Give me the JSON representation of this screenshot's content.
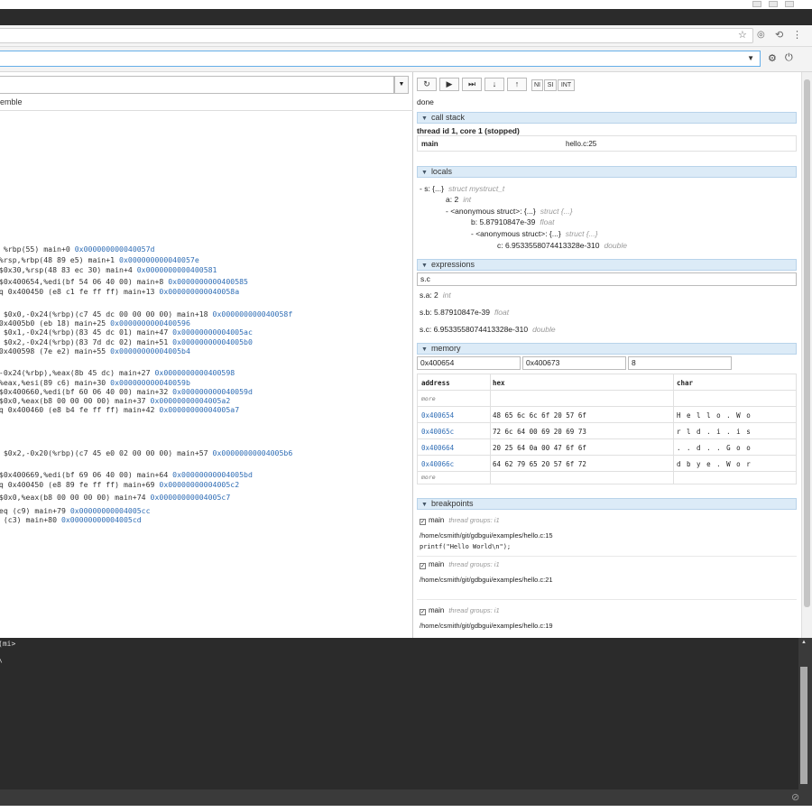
{
  "browser": {
    "star_icon": "star-icon",
    "window_controls": [
      "minimize",
      "maximize",
      "close"
    ]
  },
  "topbar": {
    "command_value": "",
    "settings_icon": "gear-icon",
    "power_icon": "power-icon"
  },
  "source": {
    "file_value": "",
    "disassemble_label": "emble",
    "asm_lines": [
      {
        "pre": "n %rbp(55) main+0 ",
        "addr": "0x000000000040057d"
      },
      {
        "pre": " %rsp,%rbp(48 89 e5) main+1 ",
        "addr": "0x000000000040057e"
      },
      {
        "pre": " $0x30,%rsp(48 83 ec 30) main+4 ",
        "addr": "0x0000000000400581"
      },
      {
        "pre": " $0x400654,%edi(bf 54 06 40 00) main+8 ",
        "addr": "0x0000000000400585"
      },
      {
        "pre": "lq 0x400450 (e8 c1 fe ff ff) main+13 ",
        "addr": "0x000000000040058a"
      },
      {
        "pre": "l $0x0,-0x24(%rbp)(c7 45 dc 00 00 00 00) main+18 ",
        "addr": "0x000000000040058f"
      },
      {
        "pre": " 0x4005b0 (eb 18) main+25 ",
        "addr": "0x0000000000400596"
      },
      {
        "pre": "l $0x1,-0x24(%rbp)(83 45 dc 01) main+47 ",
        "addr": "0x00000000004005ac"
      },
      {
        "pre": "l $0x2,-0x24(%rbp)(83 7d dc 02) main+51 ",
        "addr": "0x00000000004005b0"
      },
      {
        "pre": " 0x400598 (7e e2) main+55 ",
        "addr": "0x00000000004005b4"
      },
      {
        "pre": " -0x24(%rbp),%eax(8b 45 dc) main+27 ",
        "addr": "0x0000000000400598"
      },
      {
        "pre": " %eax,%esi(89 c6) main+30 ",
        "addr": "0x000000000040059b"
      },
      {
        "pre": " $0x400660,%edi(bf 60 06 40 00) main+32 ",
        "addr": "0x000000000040059d"
      },
      {
        "pre": " $0x0,%eax(b8 00 00 00 00) main+37 ",
        "addr": "0x00000000004005a2"
      },
      {
        "pre": "lq 0x400460 (e8 b4 fe ff ff) main+42 ",
        "addr": "0x00000000004005a7"
      },
      {
        "pre": "l $0x2,-0x20(%rbp)(c7 45 e0 02 00 00 00) main+57 ",
        "addr": "0x00000000004005b6"
      },
      {
        "pre": " $0x400669,%edi(bf 69 06 40 00) main+64 ",
        "addr": "0x00000000004005bd"
      },
      {
        "pre": "lq 0x400450 (e8 89 fe ff ff) main+69 ",
        "addr": "0x00000000004005c2"
      },
      {
        "pre": " $0x0,%eax(b8 00 00 00 00) main+74 ",
        "addr": "0x00000000004005c7"
      },
      {
        "pre": "veq (c9) main+79 ",
        "addr": "0x00000000004005cc"
      },
      {
        "pre": "q (c3) main+80 ",
        "addr": "0x00000000004005cd"
      }
    ]
  },
  "controls": {
    "ni": "NI",
    "si": "SI",
    "int": "INT",
    "status": "done"
  },
  "callstack": {
    "title": "call stack",
    "thread": "thread id 1, core 1 (stopped)",
    "frame_func": "main",
    "frame_loc": "hello.c:25"
  },
  "locals": {
    "title": "locals",
    "l1": "- s: {...}",
    "l1t": "struct mystruct_t",
    "l2": "a: 2",
    "l2t": "int",
    "l3": "- <anonymous struct>: {...}",
    "l3t": "struct {...}",
    "l4": "b: 5.87910847e-39",
    "l4t": "float",
    "l5": "- <anonymous struct>: {...}",
    "l5t": "struct {...}",
    "l6": "c: 6.9533558074413328e-310",
    "l6t": "double"
  },
  "expressions": {
    "title": "expressions",
    "input": "s.c",
    "e1": "s.a: 2",
    "e1t": "int",
    "e2": "s.b: 5.87910847e-39",
    "e2t": "float",
    "e3": "s.c: 6.9533558074413328e-310",
    "e3t": "double"
  },
  "memory": {
    "title": "memory",
    "start": "0x400654",
    "end": "0x400673",
    "bytes": "8",
    "col_address": "address",
    "col_hex": "hex",
    "col_char": "char",
    "more": "more",
    "rows": [
      {
        "addr": "0x400654",
        "hex": "48 65 6c 6c 6f 20 57 6f",
        "chr": "H e l l o . W o"
      },
      {
        "addr": "0x40065c",
        "hex": "72 6c 64 00 69 20 69 73",
        "chr": "r l d . i . i s"
      },
      {
        "addr": "0x400664",
        "hex": "20 25 64 0a 00 47 6f 6f",
        "chr": ". . d . . G o o"
      },
      {
        "addr": "0x40066c",
        "hex": "64 62 79 65 20 57 6f 72",
        "chr": "d b y e . W o r"
      }
    ]
  },
  "breakpoints": {
    "title": "breakpoints",
    "items": [
      {
        "func": "main",
        "groups": "thread groups: i1",
        "path": "/home/csmith/git/gdbgui/examples/hello.c:15",
        "code": "printf(\"Hello World\\n\");"
      },
      {
        "func": "main",
        "groups": "thread groups: i1",
        "path": "/home/csmith/git/gdbgui/examples/hello.c:21",
        "code": ""
      },
      {
        "func": "main",
        "groups": "thread groups: i1",
        "path": "/home/csmith/git/gdbgui/examples/hello.c:19",
        "code": ""
      }
    ]
  },
  "terminal": {
    "line1": "(mi>",
    "line2": "\\"
  },
  "colors": {
    "section_header": "#dcebf7",
    "link": "#2f6db5",
    "terminal_bg": "#2b2b2b"
  }
}
